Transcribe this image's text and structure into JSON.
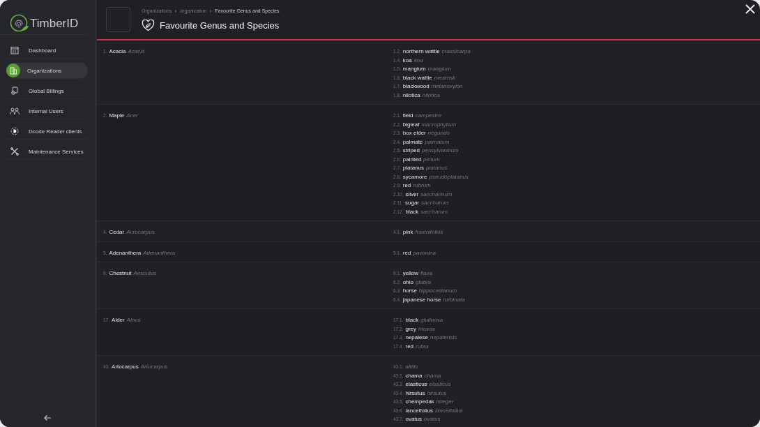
{
  "app": {
    "logo_text": "TimberID"
  },
  "sidebar": {
    "items": [
      {
        "label": "Dashboard",
        "selected": false
      },
      {
        "label": "Organizations",
        "selected": true
      },
      {
        "label": "Global Billings",
        "selected": false
      },
      {
        "label": "Internal Users",
        "selected": false
      },
      {
        "label": "Dcode Reader clients",
        "selected": false
      },
      {
        "label": "Maintenance Services",
        "selected": false
      }
    ]
  },
  "breadcrumb": [
    "Organizations",
    "organization",
    "Favourite Genus and Species"
  ],
  "page_title": "Favourite Genus and Species",
  "genera": [
    {
      "index": "1.",
      "name": "Acacia",
      "latin": "Acacia",
      "species": [
        {
          "index": "1.2.",
          "name": "northern wattle",
          "latin": "crassicarpa"
        },
        {
          "index": "1.4.",
          "name": "koa",
          "latin": "koa"
        },
        {
          "index": "1.5.",
          "name": "mangium",
          "latin": "mangium"
        },
        {
          "index": "1.6.",
          "name": "black wattle",
          "latin": "mearnsii"
        },
        {
          "index": "1.7.",
          "name": "blackwood",
          "latin": "melanoxylon"
        },
        {
          "index": "1.8.",
          "name": "nilotica",
          "latin": "nilotica"
        }
      ]
    },
    {
      "index": "2.",
      "name": "Maple",
      "latin": "Acer",
      "species": [
        {
          "index": "2.1.",
          "name": "field",
          "latin": "campestre"
        },
        {
          "index": "2.2.",
          "name": "bigleaf",
          "latin": "macrophyllum"
        },
        {
          "index": "2.3.",
          "name": "box elder",
          "latin": "negundo"
        },
        {
          "index": "2.4.",
          "name": "palmate",
          "latin": "palmatum"
        },
        {
          "index": "2.5.",
          "name": "striped",
          "latin": "pensylvanicum"
        },
        {
          "index": "2.6.",
          "name": "painted",
          "latin": "pictum"
        },
        {
          "index": "2.7.",
          "name": "platanus",
          "latin": "platanus"
        },
        {
          "index": "2.8.",
          "name": "sycamore",
          "latin": "pseudoplatanus"
        },
        {
          "index": "2.9.",
          "name": "red",
          "latin": "rubrum"
        },
        {
          "index": "2.10.",
          "name": "silver",
          "latin": "saccharinum"
        },
        {
          "index": "2.11.",
          "name": "sugar",
          "latin": "saccharum"
        },
        {
          "index": "2.12.",
          "name": "black",
          "latin": "saccharum"
        }
      ]
    },
    {
      "index": "4.",
      "name": "Cedar",
      "latin": "Acrocarpus",
      "species": [
        {
          "index": "4.1.",
          "name": "pink",
          "latin": "fraxinifolius"
        }
      ]
    },
    {
      "index": "5.",
      "name": "Adenanthera",
      "latin": "Adenanthera",
      "species": [
        {
          "index": "5.1.",
          "name": "red",
          "latin": "pavonina"
        }
      ]
    },
    {
      "index": "6.",
      "name": "Chestnut",
      "latin": "Aesculus",
      "species": [
        {
          "index": "6.1.",
          "name": "yellow",
          "latin": "flava"
        },
        {
          "index": "6.2.",
          "name": "ohio",
          "latin": "glabra"
        },
        {
          "index": "6.3.",
          "name": "horse",
          "latin": "hippocastanum"
        },
        {
          "index": "6.4.",
          "name": "japanese horse",
          "latin": "turbinata"
        }
      ]
    },
    {
      "index": "17.",
      "name": "Alder",
      "latin": "Alnus",
      "species": [
        {
          "index": "17.1.",
          "name": "black",
          "latin": "glutinosa"
        },
        {
          "index": "17.2.",
          "name": "grey",
          "latin": "incana"
        },
        {
          "index": "17.3.",
          "name": "nepalese",
          "latin": "nepalensis"
        },
        {
          "index": "17.4.",
          "name": "red",
          "latin": "rubra"
        }
      ]
    },
    {
      "index": "43.",
      "name": "Artocarpus",
      "latin": "Artocarpus",
      "species": [
        {
          "index": "43.1.",
          "latin": "altilis"
        },
        {
          "index": "43.2.",
          "name": "chama",
          "latin": "chama"
        },
        {
          "index": "43.3.",
          "name": "elasticus",
          "latin": "elasticus"
        },
        {
          "index": "43.4.",
          "name": "hirsutus",
          "latin": "hirsutus"
        },
        {
          "index": "43.5.",
          "name": "chempedak",
          "latin": "integer"
        },
        {
          "index": "43.6.",
          "name": "lanceifolius",
          "latin": "lanceifolius"
        },
        {
          "index": "43.7.",
          "name": "ovatus",
          "latin": "ovatus"
        }
      ]
    }
  ]
}
